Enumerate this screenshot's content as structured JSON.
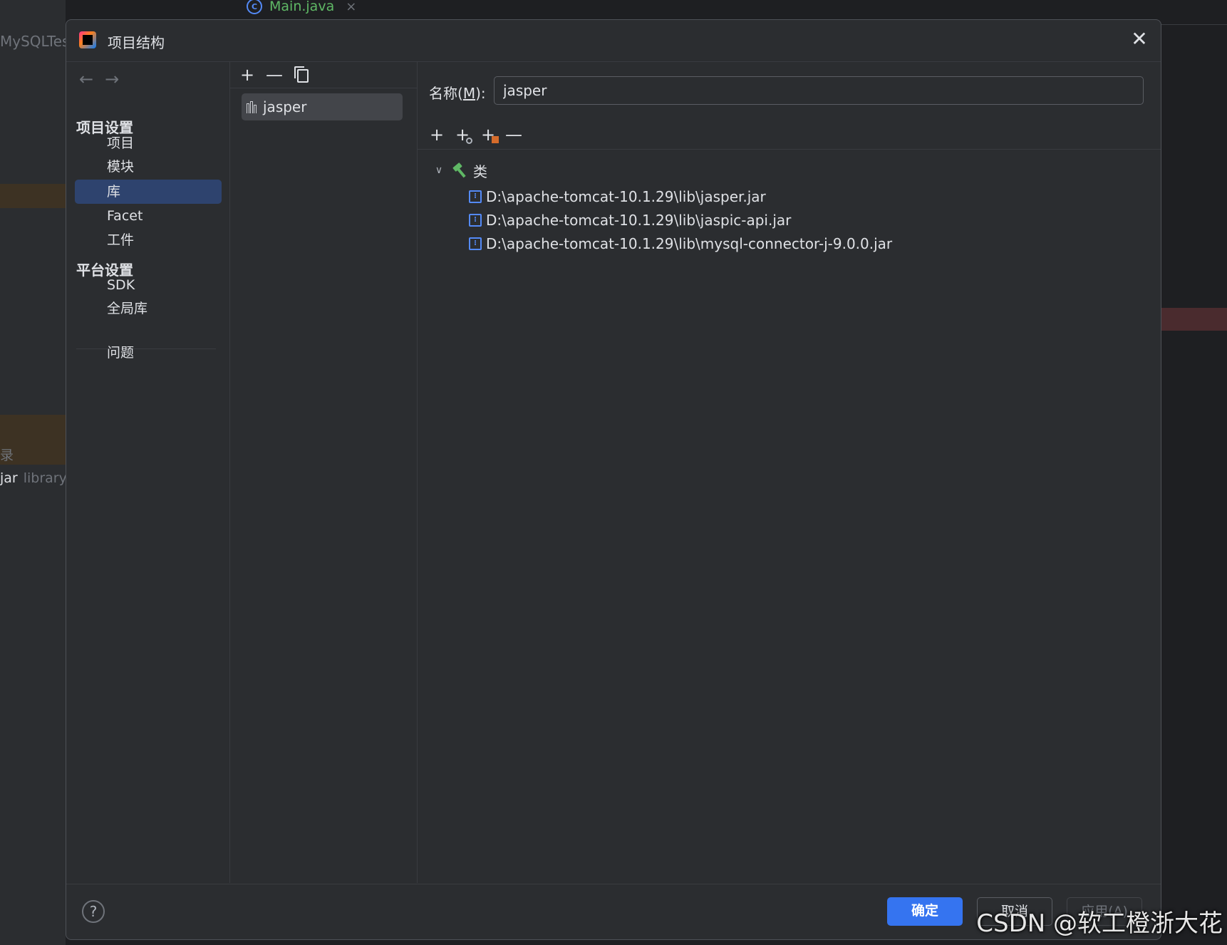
{
  "ide": {
    "project_name_fragment": "MySQLTes",
    "tab_label": "Main.java",
    "tab_close": "×",
    "left_fragment_1": "录",
    "left_fragment_2": "jar",
    "left_fragment_2_muted": "library"
  },
  "dialog": {
    "title": "项目结构",
    "close": "✕"
  },
  "sidebar": {
    "back": "←",
    "forward": "→",
    "project_settings_title": "项目设置",
    "project_settings_items": [
      {
        "label": "项目"
      },
      {
        "label": "模块"
      },
      {
        "label": "库",
        "selected": true
      },
      {
        "label": "Facet"
      },
      {
        "label": "工件"
      }
    ],
    "platform_settings_title": "平台设置",
    "platform_settings_items": [
      {
        "label": "SDK"
      },
      {
        "label": "全局库"
      }
    ],
    "problems_label": "问题"
  },
  "library_list": {
    "toolbar": {
      "add": "+",
      "remove": "—"
    },
    "items": [
      {
        "label": "jasper",
        "selected": true
      }
    ]
  },
  "detail": {
    "name_label_prefix": "名称(",
    "name_label_mnemonic": "M",
    "name_label_suffix": "):",
    "name_value": "jasper",
    "toolbar": {
      "add": "+",
      "remove": "—"
    },
    "tree": {
      "root_label": "类",
      "expanded": true,
      "children": [
        {
          "path": "D:\\apache-tomcat-10.1.29\\lib\\jasper.jar"
        },
        {
          "path": "D:\\apache-tomcat-10.1.29\\lib\\jaspic-api.jar"
        },
        {
          "path": "D:\\apache-tomcat-10.1.29\\lib\\mysql-connector-j-9.0.0.jar"
        }
      ]
    }
  },
  "footer": {
    "help": "?",
    "ok": "确定",
    "cancel": "取消",
    "apply": "应用(A)"
  },
  "watermark": "CSDN @软工橙浙大花",
  "colors": {
    "accent": "#3574f0",
    "selection": "#2e436e",
    "jar_icon": "#548af7",
    "hammer_icon": "#5fb865"
  }
}
